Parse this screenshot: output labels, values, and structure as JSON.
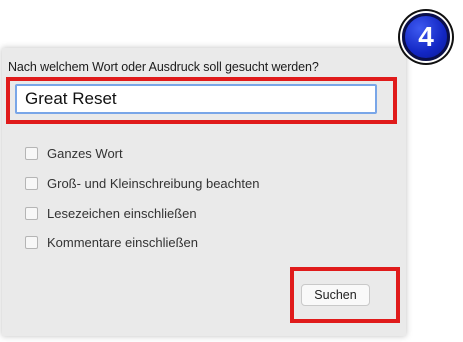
{
  "badge": {
    "number": "4",
    "color": "#1327c4"
  },
  "dialog": {
    "prompt": "Nach welchem Wort oder Ausdruck soll gesucht werden?",
    "search_value": "Great Reset",
    "options": [
      {
        "label": "Ganzes Wort",
        "checked": false
      },
      {
        "label": "Groß- und Kleinschreibung beachten",
        "checked": false
      },
      {
        "label": "Lesezeichen einschließen",
        "checked": false
      },
      {
        "label": "Kommentare einschließen",
        "checked": false
      }
    ],
    "search_button_label": "Suchen"
  },
  "highlight_color": "#e01b1b",
  "field_focus_color": "#79a6e8"
}
